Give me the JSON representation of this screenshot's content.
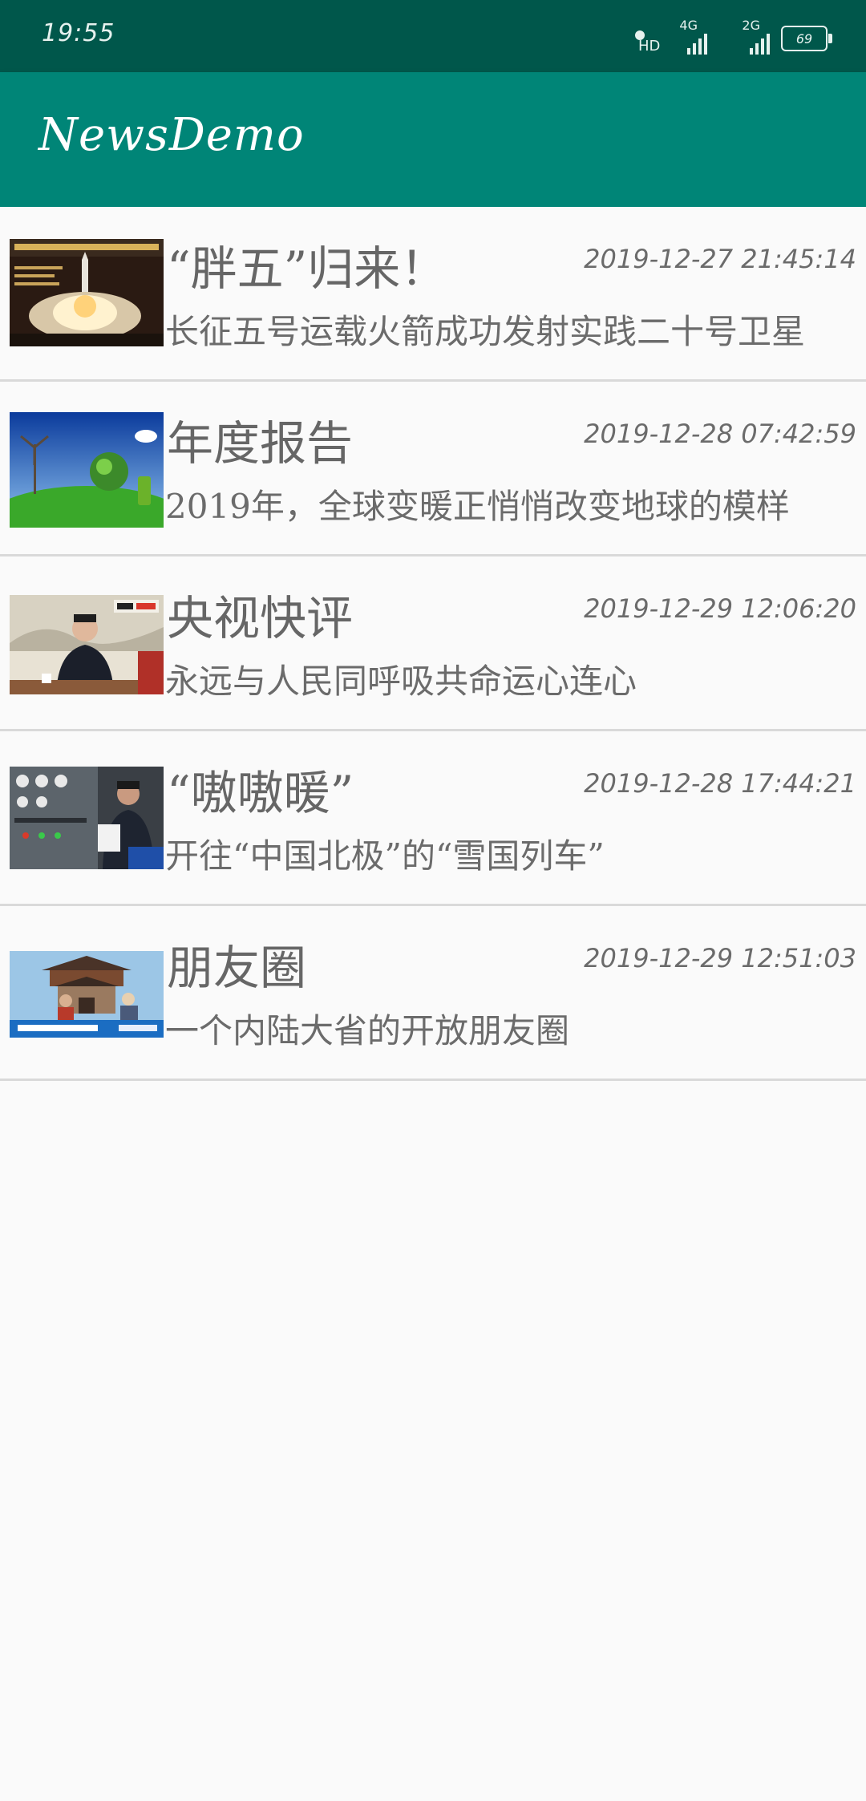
{
  "status_bar": {
    "time": "19:55",
    "network_1": "4G",
    "network_hd": "HD",
    "network_2": "2G",
    "battery": "69"
  },
  "app_bar": {
    "title": "NewsDemo"
  },
  "news": [
    {
      "title": "“胖五”归来！",
      "time": "2019-12-27 21:45:14",
      "desc": "长征五号运载火箭成功发射实践二十号卫星",
      "image": "rocket-launch-thumbnail"
    },
    {
      "title": "年度报告",
      "time": "2019-12-28 07:42:59",
      "desc": "2019年，全球变暖正悄悄改变地球的模样",
      "image": "green-earth-thumbnail"
    },
    {
      "title": "央视快评",
      "time": "2019-12-29 12:06:20",
      "desc": "永远与人民同呼吸共命运心连心",
      "image": "official-speech-thumbnail"
    },
    {
      "title": "“嗷嗷暖”",
      "time": "2019-12-28 17:44:21",
      "desc": "开往“中国北极”的“雪国列车”",
      "image": "train-worker-thumbnail"
    },
    {
      "title": "朋友圈",
      "time": "2019-12-29 12:51:03",
      "desc": "一个内陆大省的开放朋友圈",
      "image": "city-gate-thumbnail"
    }
  ]
}
